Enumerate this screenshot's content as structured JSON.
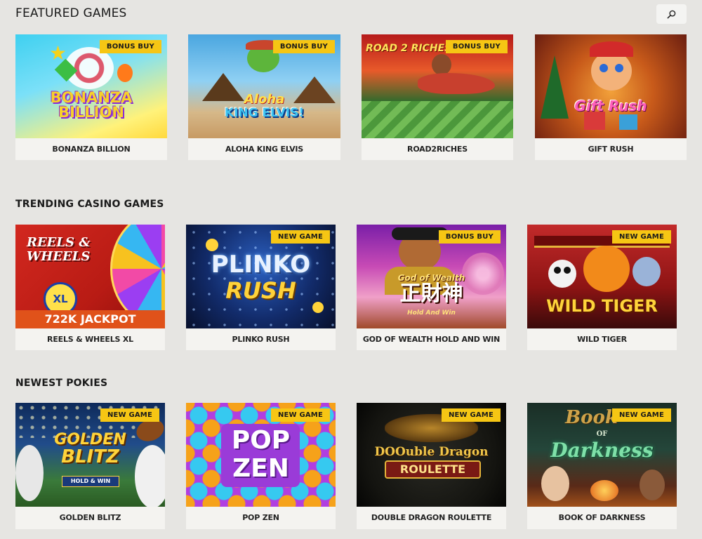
{
  "sections": {
    "featured": {
      "title": "FEATURED GAMES",
      "games": [
        {
          "name": "BONANZA BILLION",
          "badge": "BONUS BUY",
          "art_text": "BONANZA BILLION"
        },
        {
          "name": "ALOHA KING ELVIS",
          "badge": "BONUS BUY",
          "art_text_1": "Aloha",
          "art_text_2": "KING ELVIS!"
        },
        {
          "name": "ROAD2RICHES",
          "badge": "BONUS BUY",
          "art_text": "ROAD 2 RICHES"
        },
        {
          "name": "GIFT RUSH",
          "badge": "",
          "art_text": "Gift Rush"
        }
      ]
    },
    "trending": {
      "title": "TRENDING CASINO GAMES",
      "games": [
        {
          "name": "REELS & WHEELS XL",
          "badge": "",
          "art_text_1": "REELS & WHEELS",
          "art_text_2": "XL",
          "art_text_3": "722K JACKPOT"
        },
        {
          "name": "PLINKO RUSH",
          "badge": "NEW GAME",
          "art_text_1": "PLINKO",
          "art_text_2": "RUSH"
        },
        {
          "name": "GOD OF WEALTH HOLD AND WIN",
          "badge": "BONUS BUY",
          "art_text_1": "God of Wealth",
          "art_text_2": "正財神",
          "art_text_3": "Hold And Win"
        },
        {
          "name": "WILD TIGER",
          "badge": "NEW GAME",
          "art_text": "WILD TIGER"
        }
      ]
    },
    "newest": {
      "title": "NEWEST POKIES",
      "games": [
        {
          "name": "GOLDEN BLITZ",
          "badge": "NEW GAME",
          "art_text_1": "GOLDEN",
          "art_text_2": "BLITZ",
          "art_text_3": "HOLD & WIN"
        },
        {
          "name": "POP ZEN",
          "badge": "NEW GAME",
          "art_text_1": "POP",
          "art_text_2": "ZEN"
        },
        {
          "name": "DOUBLE DRAGON ROULETTE",
          "badge": "NEW GAME",
          "art_text_1": "DOOuble Dragon",
          "art_text_2": "ROULETTE"
        },
        {
          "name": "BOOK OF DARKNESS",
          "badge": "NEW GAME",
          "art_text_1": "Book",
          "art_text_2": "OF",
          "art_text_3": "Darkness"
        }
      ]
    }
  },
  "search": {
    "icon": "search-icon"
  },
  "colors": {
    "badge": "#f6c614",
    "page_bg": "#e6e5e2",
    "card_bg": "#f4f3f0"
  }
}
